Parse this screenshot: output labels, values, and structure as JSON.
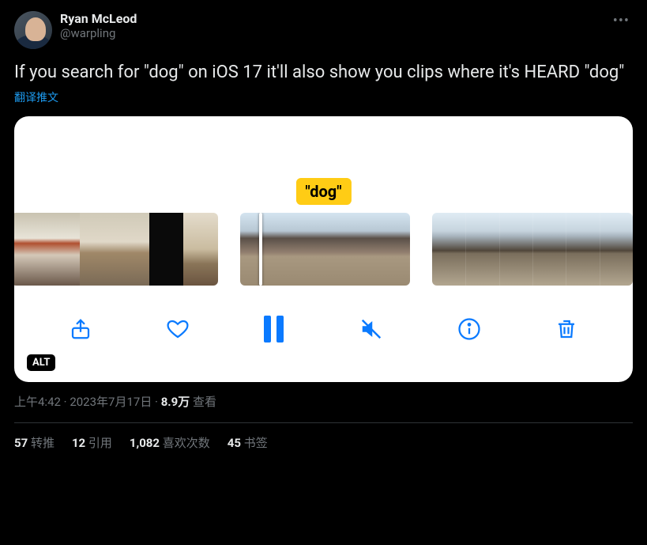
{
  "author": {
    "display_name": "Ryan McLeod",
    "handle": "@warpling"
  },
  "tweet_text": "If you search for \"dog\" on iOS 17 it'll also show you clips where it's HEARD \"dog\"",
  "translate_label": "翻译推文",
  "media": {
    "search_pill": "\"dog\"",
    "alt_badge": "ALT",
    "toolbar_icons": {
      "share": "share-icon",
      "heart": "heart-icon",
      "pause": "pause-icon",
      "mute": "mute-icon",
      "info": "info-icon",
      "trash": "trash-icon"
    }
  },
  "meta": {
    "time": "上午4:42",
    "sep": " · ",
    "date": "2023年7月17日",
    "views_count": "8.9万",
    "views_label": " 查看"
  },
  "stats": {
    "retweets_count": "57",
    "retweets_label": " 转推",
    "quotes_count": "12",
    "quotes_label": " 引用",
    "likes_count": "1,082",
    "likes_label": " 喜欢次数",
    "bookmarks_count": "45",
    "bookmarks_label": " 书签"
  }
}
